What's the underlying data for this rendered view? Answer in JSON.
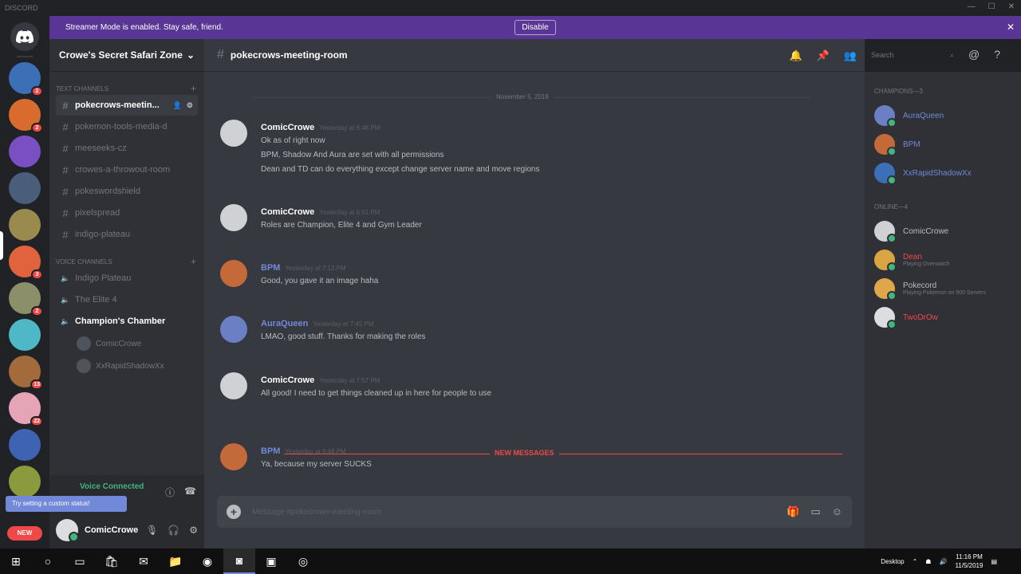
{
  "window": {
    "title": "DISCORD"
  },
  "banner": {
    "message": "Streamer Mode is enabled. Stay safe, friend.",
    "disable_label": "Disable",
    "color": "#593695"
  },
  "guilds": {
    "items": [
      {
        "color": "#3b6fb6",
        "badge": "2"
      },
      {
        "color": "#d96b2f",
        "badge": "2"
      },
      {
        "color": "#7b4fc4",
        "badge": ""
      },
      {
        "color": "#4a5d7a",
        "badge": ""
      },
      {
        "color": "#9a8a4e",
        "badge": ""
      },
      {
        "color": "#e0633d",
        "badge": "3"
      },
      {
        "color": "#8b8f6a",
        "badge": "2"
      },
      {
        "color": "#4fb8c6",
        "badge": ""
      },
      {
        "color": "#a36a3c",
        "badge": "13"
      },
      {
        "color": "#e6a5b6",
        "badge": "22"
      },
      {
        "color": "#3d63b2",
        "badge": ""
      },
      {
        "color": "#8a9a3c",
        "badge": ""
      }
    ],
    "new_label": "NEW"
  },
  "sidebar": {
    "server_name": "Crowe's Secret Safari Zone",
    "text_category": "Text Channels",
    "text_channels": [
      "pokecrows-meetin...",
      "pokemon-tools-media-d",
      "meeseeks-cz",
      "crowes-a-throwout-room",
      "pokeswordshield",
      "pixelspread",
      "indigo-plateau"
    ],
    "voice_category": "Voice Channels",
    "voice_channels": [
      "Indigo Plateau",
      "The Elite 4",
      "Champion's Chamber"
    ],
    "voice_users": [
      "ComicCrowe",
      "XxRapidShadowXx"
    ],
    "voice_status": "Voice Connected",
    "toast": "Try setting a custom status!",
    "username": "ComicCrowe"
  },
  "chat": {
    "channel_name": "pokecrows-meeting-room",
    "date_divider": "November 5, 2019",
    "new_label": "NEW MESSAGES",
    "placeholder": "Message #pokecrows-meeting-room",
    "messages": [
      {
        "author": "ComicCrowe",
        "time": "Yesterday at 6:48 PM",
        "lines": [
          "Ok as of right now",
          "BPM, Shadow And Aura are set with all permissions",
          "Dean and TD can do everything except change server name and move regions"
        ]
      },
      {
        "author": "ComicCrowe",
        "time": "Yesterday at 6:51 PM",
        "lines": [
          "Roles are Champion, Elite 4 and Gym Leader"
        ]
      },
      {
        "author": "BPM",
        "time": "Yesterday at 7:13 PM",
        "lines": [
          "Good, you gave it an image haha"
        ]
      },
      {
        "author": "AuraQueen",
        "time": "Yesterday at 7:45 PM",
        "lines": [
          "LMAO, good stuff. Thanks for making the roles"
        ]
      },
      {
        "author": "ComicCrowe",
        "time": "Yesterday at 7:57 PM",
        "lines": [
          "All good! I need to get things cleaned up in here for people to use"
        ]
      },
      {
        "author": "BPM",
        "time": "Yesterday at 9:48 PM",
        "lines": [
          "Ya, because my server SUCKS"
        ]
      }
    ]
  },
  "search": {
    "placeholder": "Search"
  },
  "members": {
    "champions_label": "Champions—3",
    "champions": [
      "AuraQueen",
      "BPM",
      "XxRapidShadowXx"
    ],
    "online_label": "Online—4",
    "online": [
      {
        "name": "ComicCrowe",
        "sub": "",
        "color": "#b9bbbe"
      },
      {
        "name": "Dean",
        "sub": "Playing Overwatch",
        "color": "#f04747"
      },
      {
        "name": "Pokecord",
        "sub": "Playing Pokemon on 900 Servers",
        "color": "#b9bbbe"
      },
      {
        "name": "TwoDrOw",
        "sub": "",
        "color": "#f04747"
      }
    ]
  },
  "taskbar": {
    "time": "11:16 PM",
    "date": "11/5/2019",
    "desktop_label": "Desktop"
  }
}
